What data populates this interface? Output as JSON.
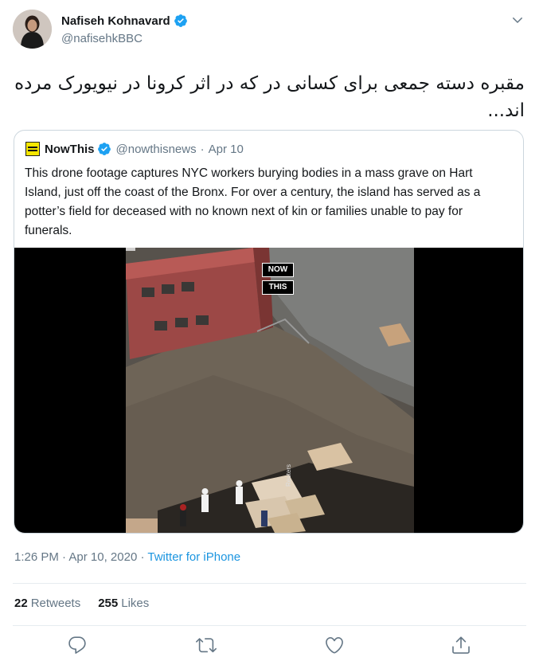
{
  "author": {
    "name": "Nafiseh Kohnavard",
    "handle": "@nafisehkBBC"
  },
  "tweet": {
    "text": "مقبره دسته جمعی برای کسانی در که در اثر کرونا در نیویورک مرده اند..."
  },
  "quoted": {
    "name": "NowThis",
    "handle": "@nowthisnews",
    "separator": "·",
    "date": "Apr 10",
    "text": "This drone footage captures NYC workers burying bodies in a mass grave on Hart Island, just off the coast of the Bronx. For over a century, the island has served as a potter’s field for deceased with no known next of kin or families unable to pay for funerals.",
    "media": {
      "badge_top": "NOW",
      "badge_bottom": "THIS",
      "credit": "Reuters"
    }
  },
  "meta": {
    "time": "1:26 PM",
    "separator": "·",
    "date": "Apr 10, 2020",
    "source": "Twitter for iPhone"
  },
  "stats": {
    "retweets_count": "22",
    "retweets_label": "Retweets",
    "likes_count": "255",
    "likes_label": "Likes"
  },
  "icons": {
    "verified": "verified-badge-icon",
    "caret": "chevron-down-icon",
    "reply": "reply-icon",
    "retweet": "retweet-icon",
    "like": "heart-icon",
    "share": "share-icon"
  },
  "colors": {
    "accent": "#1da1f2",
    "link": "#1b95e0",
    "secondary_text": "#657786",
    "border": "#ccd6dd"
  }
}
